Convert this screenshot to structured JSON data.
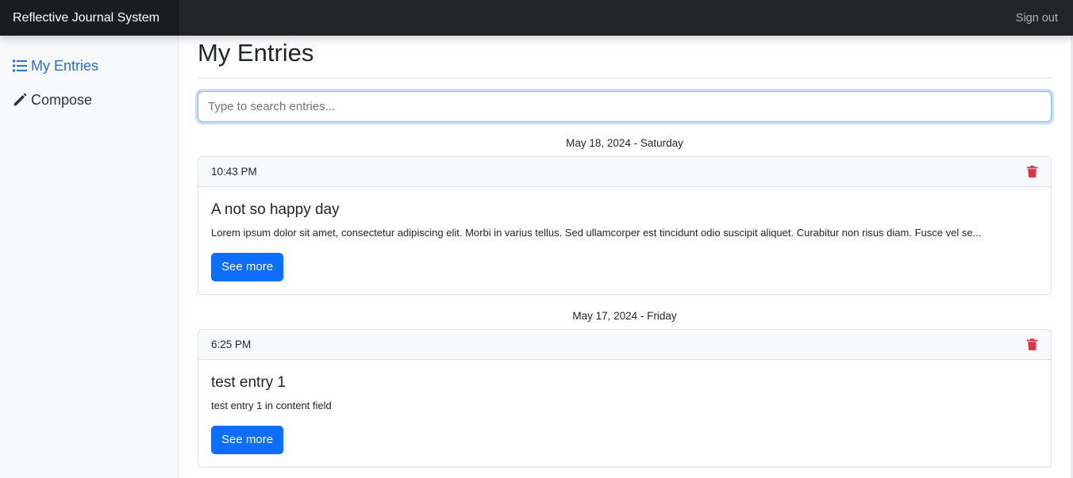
{
  "navbar": {
    "brand": "Reflective Journal System",
    "signout": "Sign out"
  },
  "sidebar": {
    "items": [
      {
        "label": "My Entries",
        "icon": "list-icon",
        "active": true
      },
      {
        "label": "Compose",
        "icon": "pencil-icon",
        "active": false
      }
    ]
  },
  "main": {
    "title": "My Entries",
    "search": {
      "placeholder": "Type to search entries...",
      "value": ""
    },
    "groups": [
      {
        "date": "May 18, 2024 - Saturday",
        "entry": {
          "time": "10:43 PM",
          "title": "A not so happy day",
          "text": "Lorem ipsum dolor sit amet, consectetur adipiscing elit. Morbi in varius tellus. Sed ullamcorper est tincidunt odio suscipit aliquet. Curabitur non risus diam. Fusce vel se...",
          "button": "See more"
        }
      },
      {
        "date": "May 17, 2024 - Friday",
        "entry": {
          "time": "6:25 PM",
          "title": "test entry 1",
          "text": "test entry 1 in content field",
          "button": "See more"
        }
      }
    ]
  },
  "colors": {
    "navbar": "#212529",
    "accent": "#0d6efd",
    "active_link": "#2470dc",
    "danger": "#dc3545"
  }
}
